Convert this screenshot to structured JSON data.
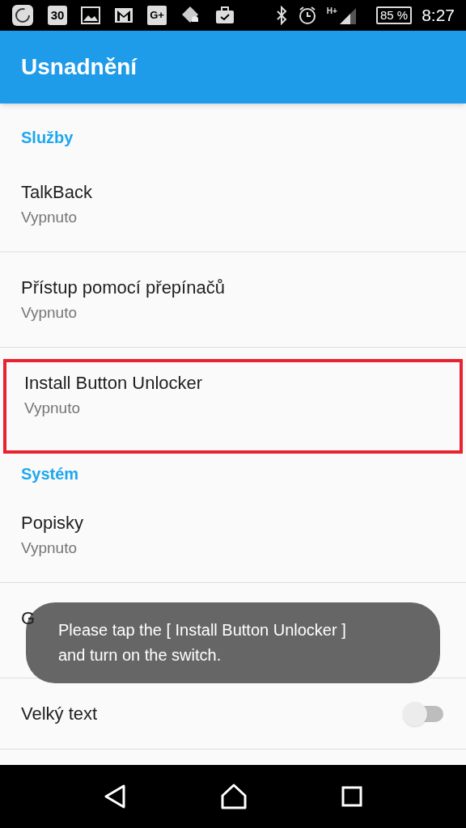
{
  "status_bar": {
    "calendar_day": "30",
    "gplus": "G+",
    "network": "H+",
    "battery": "85 %",
    "time": "8:27"
  },
  "app_bar": {
    "title": "Usnadnění"
  },
  "sections": [
    {
      "title": "Služby",
      "items": [
        {
          "kind": "service",
          "title": "TalkBack",
          "subtitle": "Vypnuto",
          "highlighted": false
        },
        {
          "kind": "service",
          "title": "Přístup pomocí přepínačů",
          "subtitle": "Vypnuto",
          "highlighted": false
        },
        {
          "kind": "service",
          "title": "Install Button Unlocker",
          "subtitle": "Vypnuto",
          "highlighted": true
        }
      ]
    },
    {
      "title": "Systém",
      "items": [
        {
          "kind": "service",
          "title": "Popisky",
          "subtitle": "Vypnuto",
          "highlighted": false
        },
        {
          "kind": "service",
          "title": "G",
          "highlighted": false
        },
        {
          "kind": "switch",
          "title": "Velký text",
          "on": false
        }
      ]
    }
  ],
  "toast": {
    "text": "Please tap the [ Install Button Unlocker ] and turn on the switch."
  }
}
